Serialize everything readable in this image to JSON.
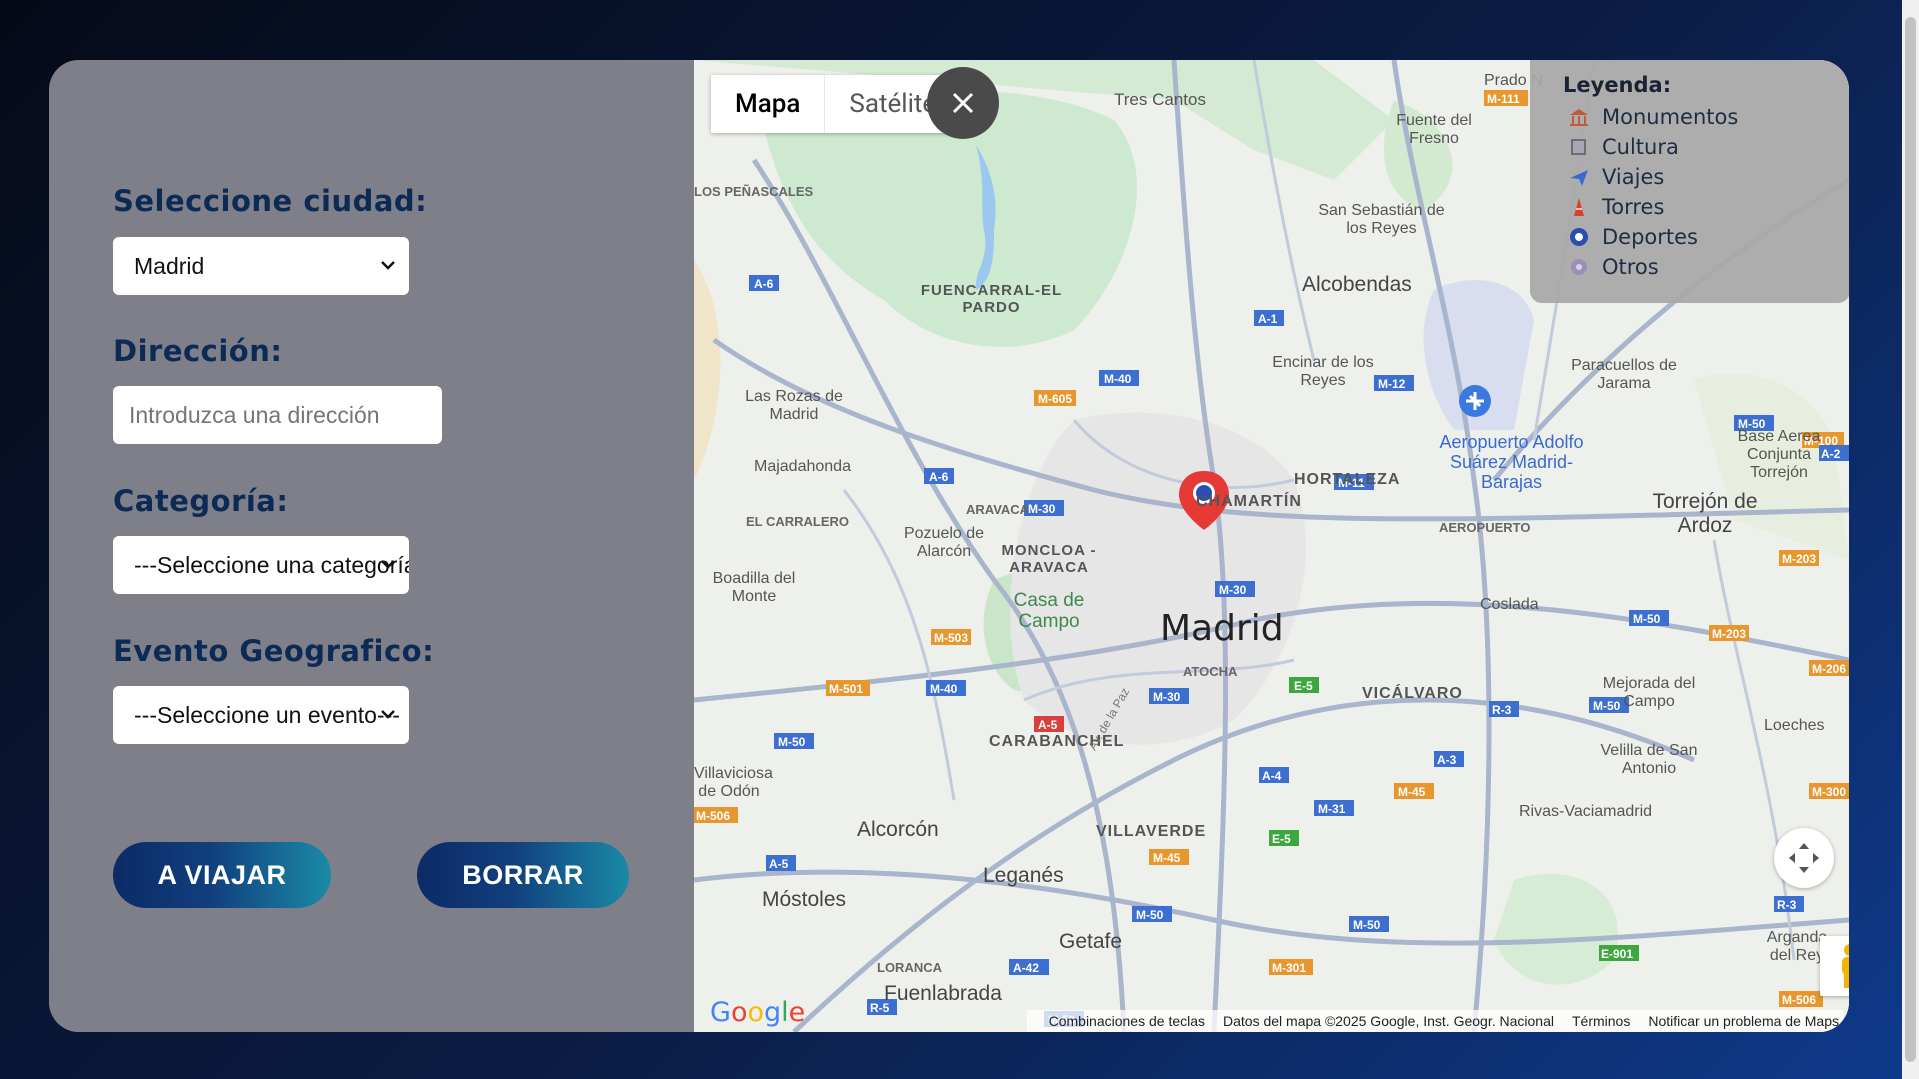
{
  "form": {
    "city": {
      "label": "Seleccione ciudad:",
      "selected": "Madrid"
    },
    "address": {
      "label": "Dirección:",
      "placeholder": "Introduzca una dirección"
    },
    "category": {
      "label": "Categoría:",
      "selected": "---Seleccione una categoría---"
    },
    "event": {
      "label": "Evento Geografico:",
      "selected": "---Seleccione un evento---"
    },
    "travel_button": "A VIAJAR",
    "clear_button": "BORRAR"
  },
  "map": {
    "map_type_map": "Mapa",
    "map_type_satellite": "Satélite",
    "legend": {
      "title": "Leyenda:",
      "items": [
        {
          "label": "Monumentos",
          "icon": "monument-icon",
          "color": "#c05a3a"
        },
        {
          "label": "Cultura",
          "icon": "book-icon",
          "color": "#6b6b7a"
        },
        {
          "label": "Viajes",
          "icon": "airplane-icon",
          "color": "#3a6ad0"
        },
        {
          "label": "Torres",
          "icon": "tower-icon",
          "color": "#d8402f"
        },
        {
          "label": "Deportes",
          "icon": "soccer-ball-icon",
          "color": "#2a4fb0"
        },
        {
          "label": "Otros",
          "icon": "gear-icon",
          "color": "#9a8fb8"
        }
      ]
    },
    "place_labels": {
      "tres_cantos": "Tres Cantos",
      "fuente_del_fresno": "Fuente del Fresno",
      "prado": "Prado N",
      "penascales": "LOS PEÑASCALES",
      "san_sebastian": "San Sebastián de los Reyes",
      "fuencarral": "FUENCARRAL-EL PARDO",
      "alcobendas": "Alcobendas",
      "encinar": "Encinar de los Reyes",
      "paracuellos": "Paracuellos de Jarama",
      "las_rozas": "Las Rozas de Madrid",
      "aeropuerto": "Aeropuerto Adolfo Suárez Madrid-Barajas",
      "majadahonda": "Majadahonda",
      "hortaleza": "HORTALEZA",
      "chamartin": "CHAMARTÍN",
      "aravaca": "ARAVACA",
      "base_aerea": "Base Aerea Conjunta Torrejón",
      "el_carralero": "EL CARRALERO",
      "pozuelo": "Pozuelo de Alarcón",
      "moncloa": "MONCLOA - ARAVACA",
      "aeropuerto_district": "AEROPUERTO",
      "torrejon": "Torrejón de Ardoz",
      "boadilla": "Boadilla del Monte",
      "casa_de_campo": "Casa de Campo",
      "madrid": "Madrid",
      "coslada": "Coslada",
      "atocha": "ATOCHA",
      "vicalvaro": "VICÁLVARO",
      "mejorada": "Mejorada del Campo",
      "carabanchel": "CARABANCHEL",
      "loeches": "Loeches",
      "velilla": "Velilla de San Antonio",
      "alcorcon": "Alcorcón",
      "villaverde": "VILLAVERDE",
      "rivas": "Rivas-Vaciamadrid",
      "leganes": "Leganés",
      "mostoles": "Móstoles",
      "getafe": "Getafe",
      "fuenlabrada": "Fuenlabrada",
      "loranca": "LORANCA",
      "arganda": "Arganda del Rey",
      "aviciosa": "Villaviciosa de Odón",
      "av_paz": "Av. de la Paz"
    },
    "footer": {
      "shortcuts": "Combinaciones de teclas",
      "data": "Datos del mapa ©2025 Google, Inst. Geogr. Nacional",
      "terms": "Términos",
      "report": "Notificar un problema de Maps"
    },
    "google": "Google"
  }
}
